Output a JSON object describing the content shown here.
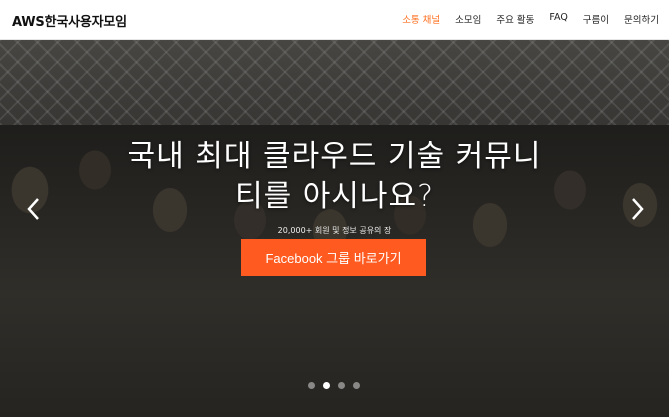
{
  "brand": "AWS한국사용자모임",
  "nav": {
    "items": [
      {
        "label": "소통 채널",
        "active": true
      },
      {
        "label": "소모임",
        "active": false
      },
      {
        "label": "주요 활동",
        "active": false
      },
      {
        "label": "FAQ",
        "active": false
      },
      {
        "label": "구름이",
        "active": false
      },
      {
        "label": "문의하기",
        "active": false
      }
    ],
    "active_color": "#ff6f1f"
  },
  "hero": {
    "headline_line1": "국내 최대 클라우드 기술 커뮤니",
    "headline_line2": "티를 아시나요?",
    "subtitle": "20,000+ 회원 및 정보 공유의 장",
    "cta_label": "Facebook 그룹 바로가기",
    "cta_color": "#ff5a1f",
    "prev_icon": "chevron-left-icon",
    "next_icon": "chevron-right-icon",
    "slides": 4,
    "active_slide": 2
  }
}
